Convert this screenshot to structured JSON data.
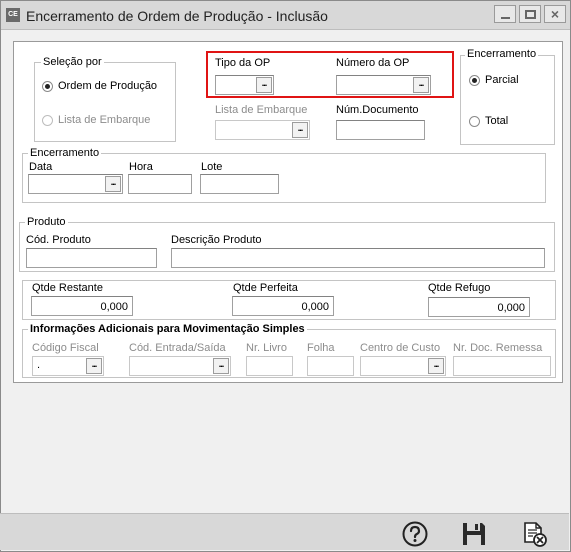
{
  "window": {
    "icon_text": "CE",
    "title": "Encerramento de Ordem de Produção - Inclusão",
    "close_glyph": "×"
  },
  "selecao": {
    "title": "Seleção por",
    "opt1": "Ordem de Produção",
    "opt2": "Lista de Embarque",
    "selected": "opt1"
  },
  "op": {
    "tipo_label": "Tipo da OP",
    "tipo_value": "",
    "numero_label": "Número da OP",
    "numero_value": "",
    "lista_label": "Lista de Embarque",
    "lista_value": "",
    "num_doc_label": "Núm.Documento",
    "num_doc_value": "",
    "highlight_color": "#e01414"
  },
  "encerramento_tipo": {
    "title": "Encerramento",
    "opt1": "Parcial",
    "opt2": "Total",
    "selected": "opt1"
  },
  "encerramento": {
    "title": "Encerramento",
    "data_label": "Data",
    "data_value": "",
    "hora_label": "Hora",
    "hora_value": "",
    "lote_label": "Lote",
    "lote_value": ""
  },
  "produto": {
    "title": "Produto",
    "cod_label": "Cód. Produto",
    "cod_value": "",
    "desc_label": "Descrição Produto",
    "desc_value": ""
  },
  "quantidades": {
    "restante_label": "Qtde Restante",
    "restante_value": "0,000",
    "perfeita_label": "Qtde Perfeita",
    "perfeita_value": "0,000",
    "refugo_label": "Qtde Refugo",
    "refugo_value": "0,000"
  },
  "info_adicionais": {
    "title": "Informações Adicionais para Movimentação Simples",
    "cod_fiscal_label": "Código Fiscal",
    "cod_fiscal_value": ".",
    "cod_entrada_label": "Cód. Entrada/Saída",
    "cod_entrada_value": "",
    "nr_livro_label": "Nr. Livro",
    "nr_livro_value": "",
    "folha_label": "Folha",
    "folha_value": "",
    "centro_custo_label": "Centro de Custo",
    "centro_custo_value": "",
    "nr_doc_remessa_label": "Nr. Doc. Remessa",
    "nr_doc_remessa_value": ""
  },
  "lookup_button_glyph": "...",
  "toolbar": {
    "help_icon": "help-icon",
    "save_icon": "save-icon",
    "cancel_icon": "cancel-document-icon"
  }
}
